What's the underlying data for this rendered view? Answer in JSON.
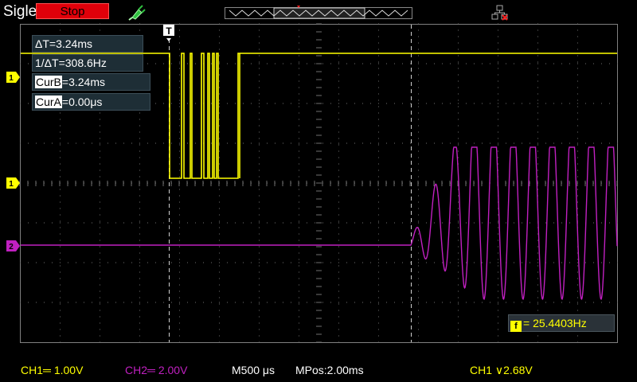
{
  "brand": "Siglent",
  "run_state": "Stop",
  "icons": {
    "probe": "probe-icon",
    "timebar": "timebase-position-icon",
    "network": "network-disconnected-icon"
  },
  "colors": {
    "ch1": "#ffff00",
    "ch2": "#c020c0",
    "stop": "#e0000a",
    "grid": "#707070"
  },
  "cursors": {
    "delta_t": "ΔT=3.24ms",
    "inv_delta_t": "1/ΔT=308.6Hz",
    "cur_b_tag": "CurB",
    "cur_b_value": "=3.24ms",
    "cur_a_tag": "CurA",
    "cur_a_value": "=0.00μs"
  },
  "markers": {
    "trigger_top": "T",
    "ch1_level": "1",
    "ch1_marker": "1",
    "ch2_marker": "2"
  },
  "measurement": {
    "tag": "f",
    "value": "= 25.4403Hz"
  },
  "status": {
    "ch1": "CH1═ 1.00V",
    "ch2": "CH2═ 2.00V",
    "timebase": "M500 μs",
    "mpos": "MPos:2.00ms",
    "trigger": "CH1 ∨2.68V"
  }
}
